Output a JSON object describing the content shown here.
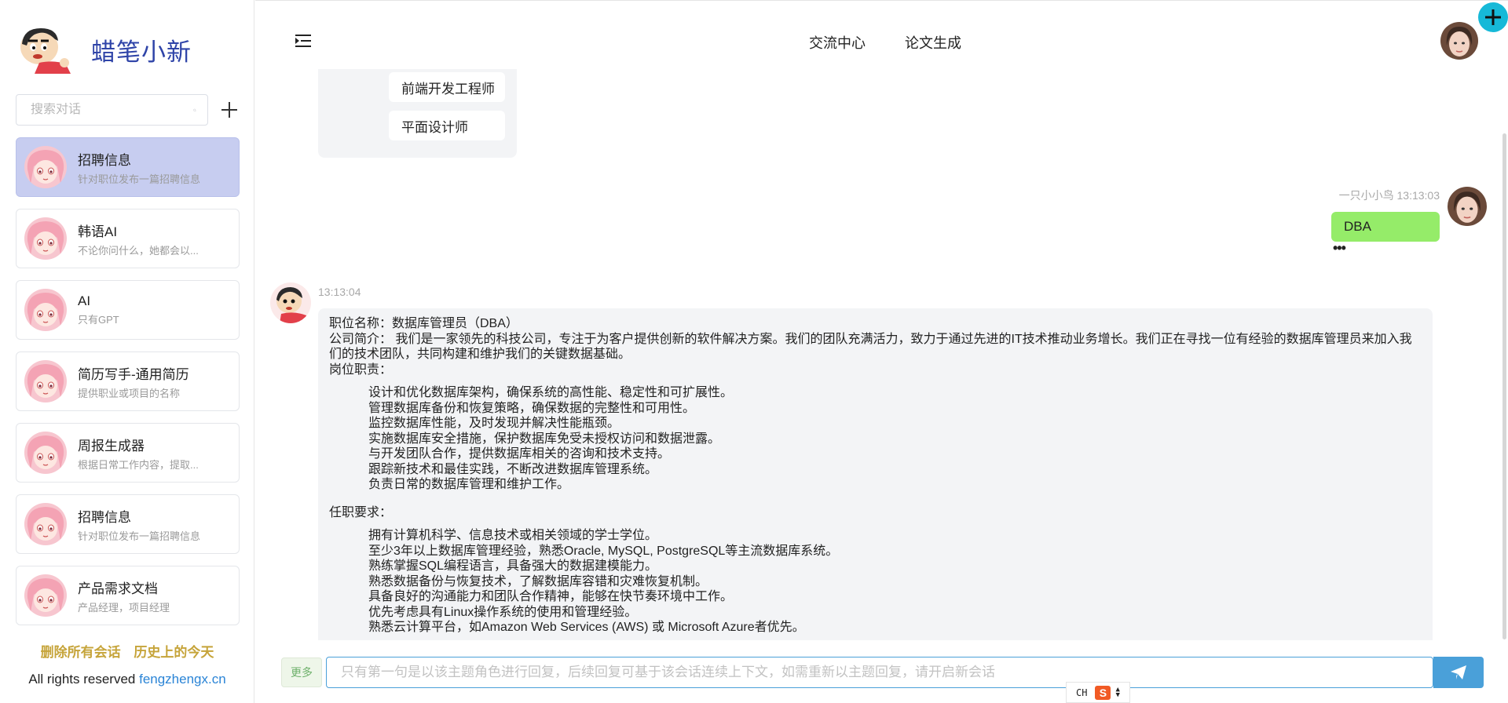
{
  "brand": {
    "name": "蜡笔小新"
  },
  "search": {
    "placeholder": "搜索对话"
  },
  "chats": [
    {
      "title": "招聘信息",
      "subtitle": "针对职位发布一篇招聘信息",
      "active": true
    },
    {
      "title": "韩语AI",
      "subtitle": "不论你问什么，她都会以...",
      "active": false
    },
    {
      "title": "AI",
      "subtitle": "只有GPT",
      "active": false
    },
    {
      "title": "简历写手-通用简历",
      "subtitle": "提供职业或项目的名称",
      "active": false
    },
    {
      "title": "周报生成器",
      "subtitle": "根据日常工作内容，提取...",
      "active": false
    },
    {
      "title": "招聘信息",
      "subtitle": "针对职位发布一篇招聘信息",
      "active": false
    },
    {
      "title": "产品需求文档",
      "subtitle": "产品经理，项目经理",
      "active": false
    }
  ],
  "sidebar_footer": {
    "delete_all": "删除所有会话",
    "today_in_history": "历史上的今天",
    "copyright_prefix": "All rights reserved ",
    "copyright_link": "fengzhengx.cn"
  },
  "header": {
    "nav": [
      "交流中心",
      "论文生成"
    ]
  },
  "options": [
    "前端开发工程师",
    "平面设计师"
  ],
  "user_message": {
    "author": "一只小小鸟",
    "time": "13:13:03",
    "text": "DBA",
    "more": "•••"
  },
  "bot_message": {
    "time": "13:13:04",
    "position": "职位名称：数据库管理员（DBA）",
    "intro": "公司简介： 我们是一家领先的科技公司，专注于为客户提供创新的软件解决方案。我们的团队充满活力，致力于通过先进的IT技术推动业务增长。我们正在寻找一位有经验的数据库管理员来加入我们的技术团队，共同构建和维护我们的关键数据基础。",
    "duties_label": "岗位职责：",
    "duties": [
      "设计和优化数据库架构，确保系统的高性能、稳定性和可扩展性。",
      "管理数据库备份和恢复策略，确保数据的完整性和可用性。",
      "监控数据库性能，及时发现并解决性能瓶颈。",
      "实施数据库安全措施，保护数据库免受未授权访问和数据泄露。",
      "与开发团队合作，提供数据库相关的咨询和技术支持。",
      "跟踪新技术和最佳实践，不断改进数据库管理系统。",
      "负责日常的数据库管理和维护工作。"
    ],
    "requirements_label": "任职要求：",
    "requirements": [
      "拥有计算机科学、信息技术或相关领域的学士学位。",
      "至少3年以上数据库管理经验，熟悉Oracle, MySQL, PostgreSQL等主流数据库系统。",
      "熟练掌握SQL编程语言，具备强大的数据建模能力。",
      "熟悉数据备份与恢复技术，了解数据库容错和灾难恢复机制。",
      "具备良好的沟通能力和团队合作精神，能够在快节奏环境中工作。",
      "优先考虑具有Linux操作系统的使用和管理经验。",
      "熟悉云计算平台，如Amazon Web Services (AWS) 或 Microsoft Azure者优先。"
    ]
  },
  "input": {
    "more_label": "更多",
    "placeholder": "只有第一句是以该主题角色进行回复，后续回复可基于该会话连续上下文，如需重新以主题回复，请开启新会话"
  },
  "ime": {
    "mode": "CH",
    "logo": "S"
  },
  "colors": {
    "brand": "#2f44a8",
    "active_chat": "#c7cdf0",
    "user_bubble": "#95ec69",
    "bot_bubble": "#f3f4f6",
    "accent": "#4aa0d9",
    "footer_links": "#c6a43a",
    "fab": "#16b9d8"
  },
  "icons": {
    "search": "search-icon",
    "add": "plus-icon",
    "menu": "menu-fold-icon",
    "send": "paper-plane-icon",
    "fab": "plus-circle-icon"
  }
}
